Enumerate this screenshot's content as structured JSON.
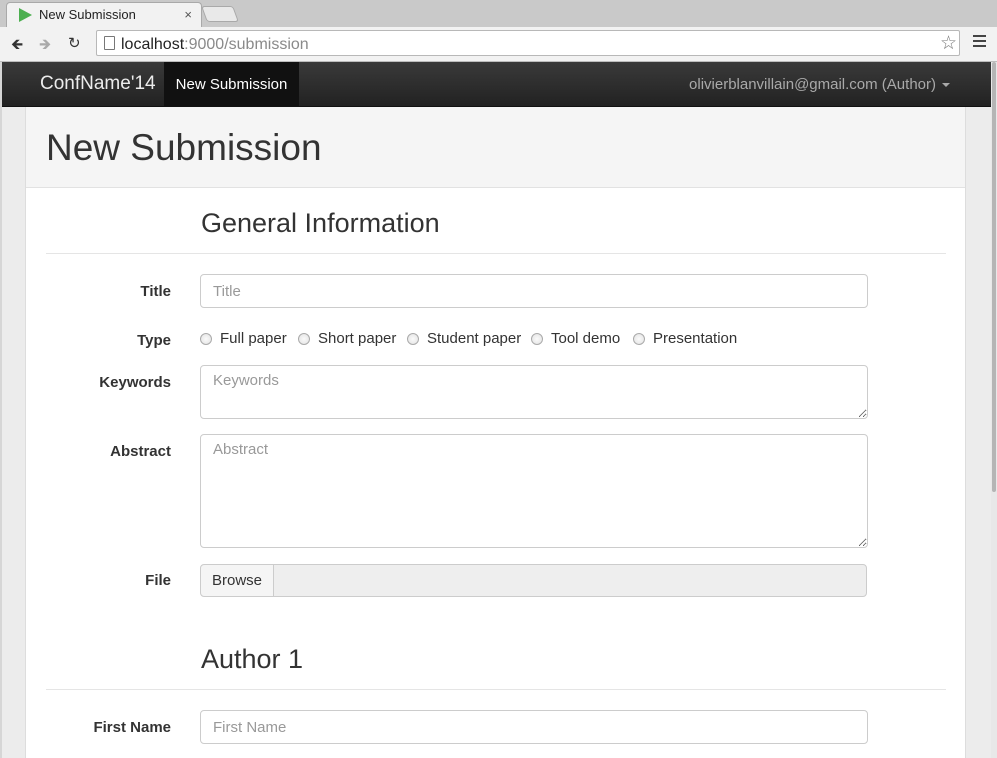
{
  "browser": {
    "tab_title": "New Submission",
    "tab_close": "×",
    "url_host": "localhost",
    "url_path": ":9000/submission"
  },
  "navbar": {
    "brand": "ConfName'14",
    "active_item": "New Submission",
    "user": "olivierblanvillain@gmail.com (Author)"
  },
  "page": {
    "title": "New Submission"
  },
  "general": {
    "heading": "General Information",
    "title_label": "Title",
    "title_placeholder": "Title",
    "type_label": "Type",
    "type_options": [
      "Full paper",
      "Short paper",
      "Student paper",
      "Tool demo",
      "Presentation"
    ],
    "keywords_label": "Keywords",
    "keywords_placeholder": "Keywords",
    "abstract_label": "Abstract",
    "abstract_placeholder": "Abstract",
    "file_label": "File",
    "browse_label": "Browse"
  },
  "author1": {
    "heading": "Author 1",
    "first_name_label": "First Name",
    "first_name_placeholder": "First Name"
  }
}
